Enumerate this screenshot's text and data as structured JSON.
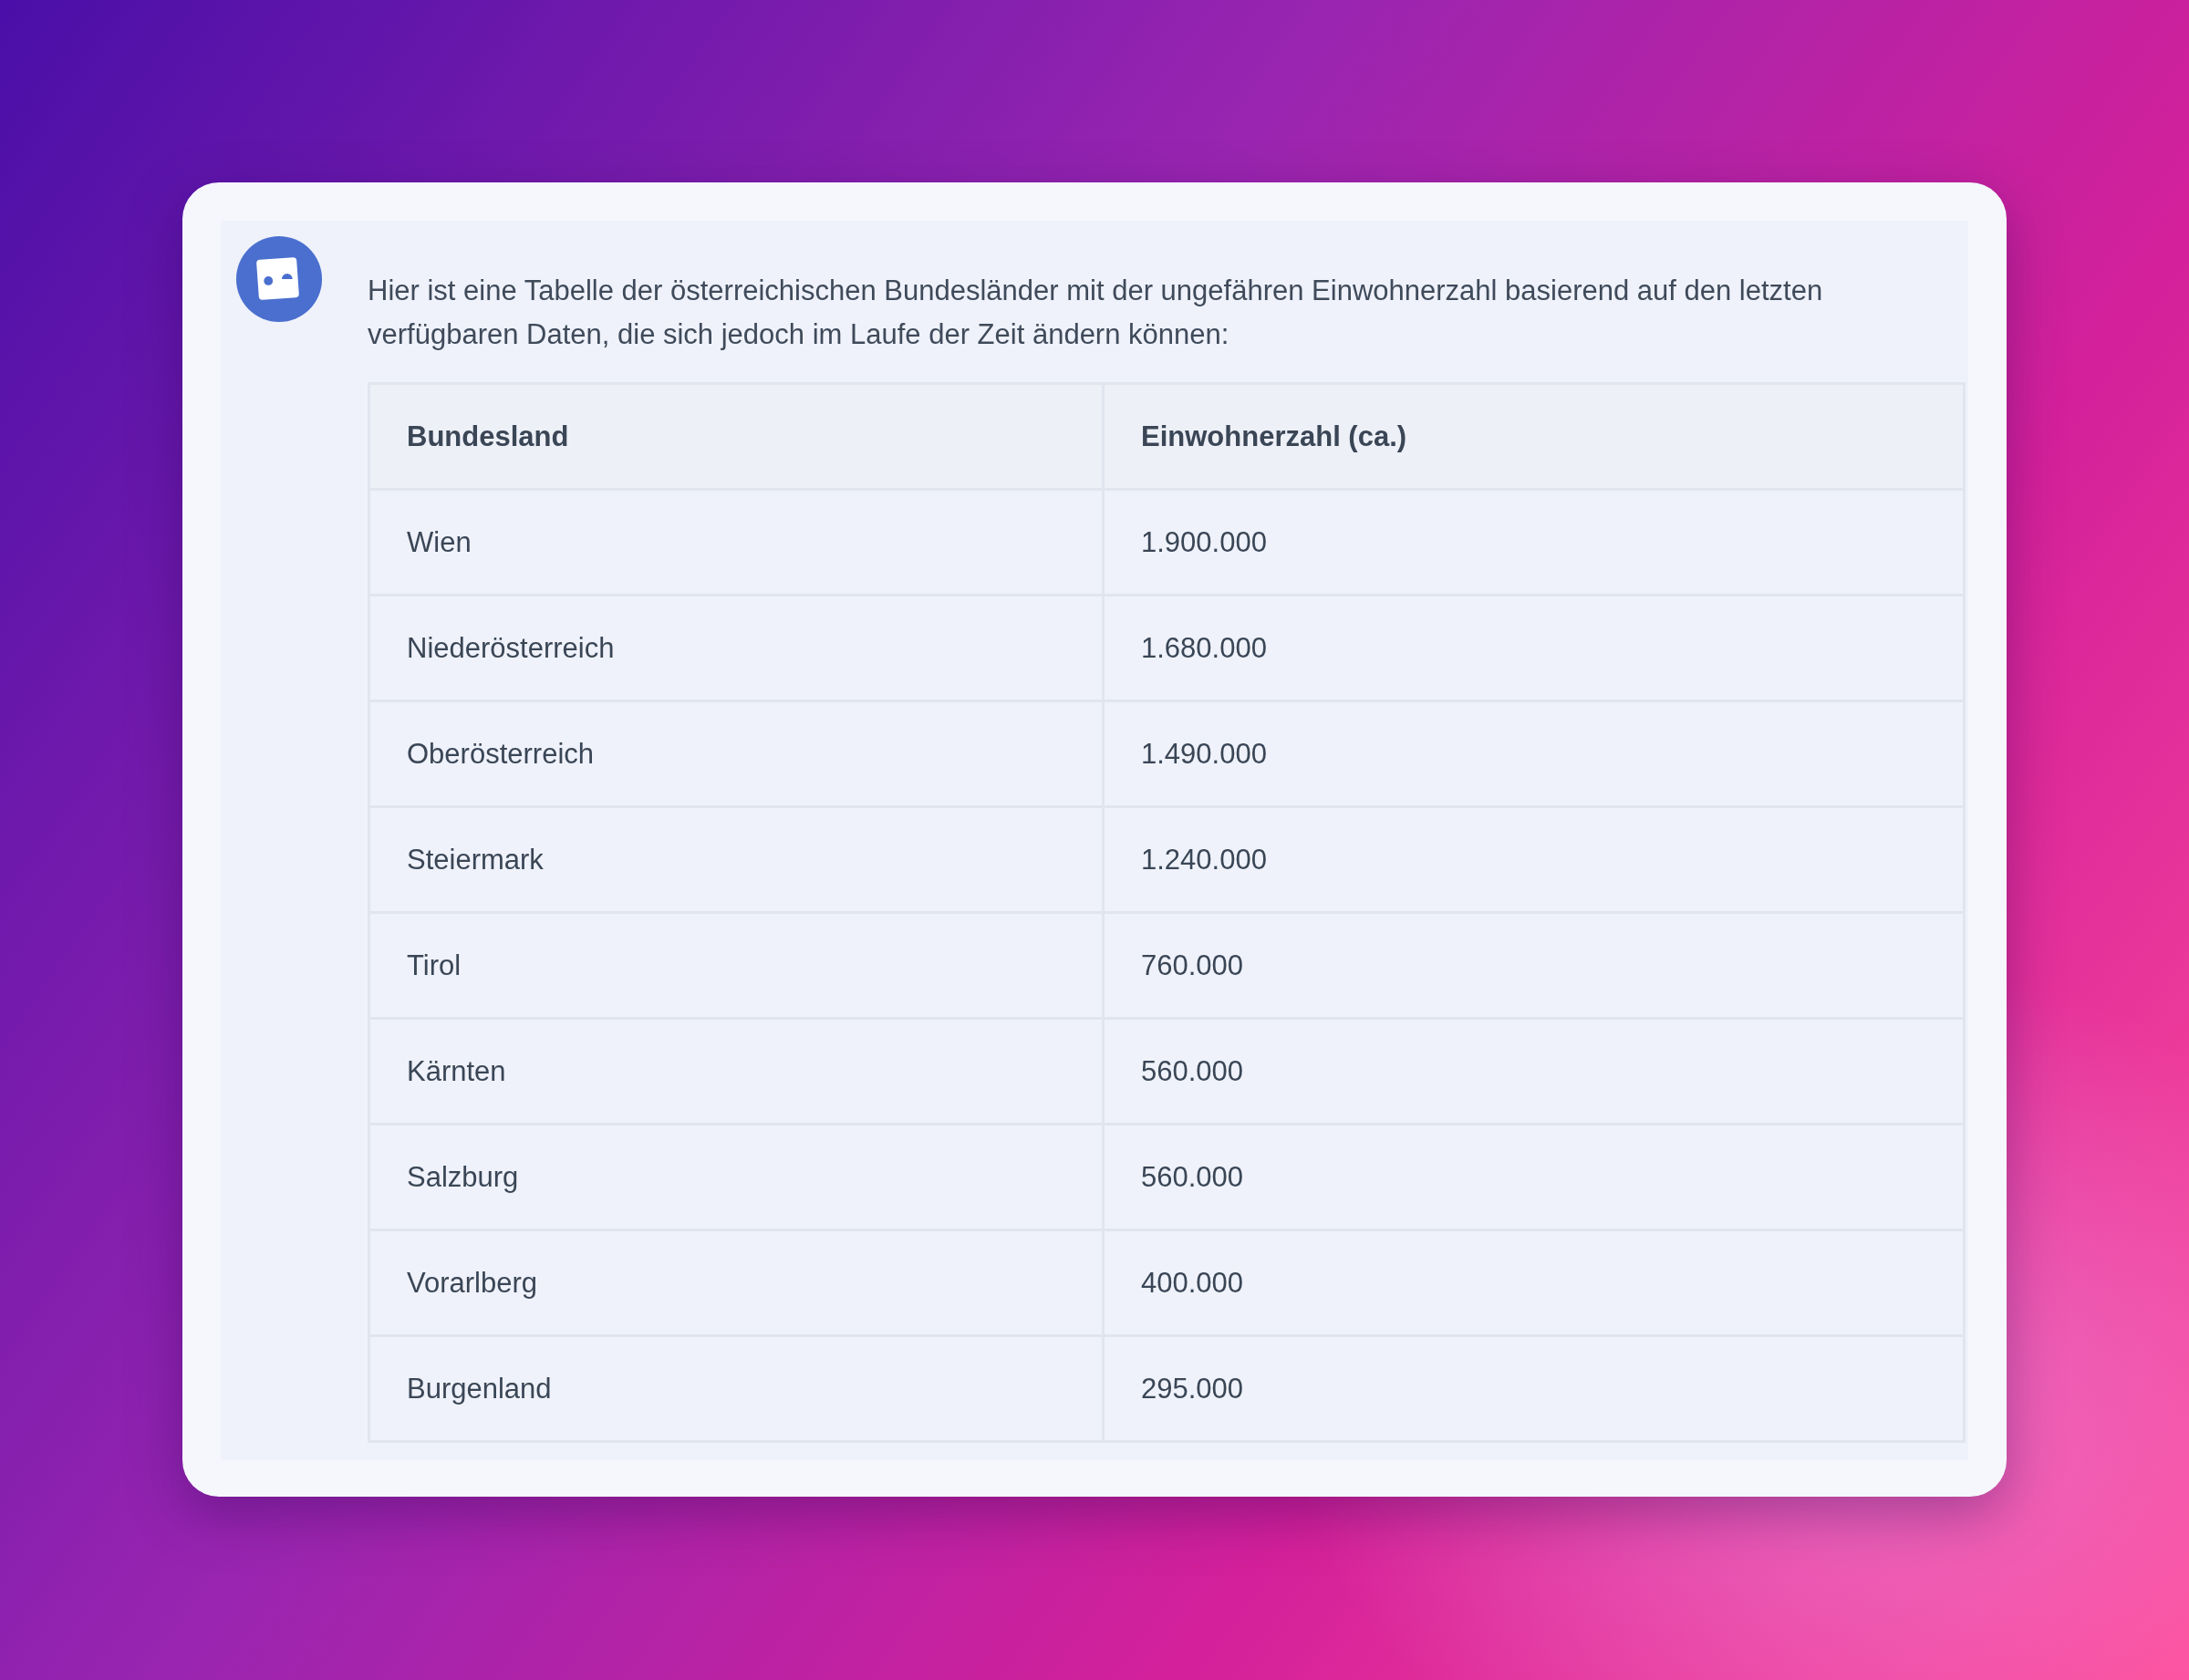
{
  "message": {
    "text": "Hier ist eine Tabelle der österreichischen Bundesländer mit der ungefähren Einwohnerzahl basierend auf den letzten verfügbaren Daten, die sich jedoch im Laufe der Zeit ändern können:"
  },
  "table": {
    "columns": [
      "Bundesland",
      "Einwohnerzahl (ca.)"
    ],
    "rows": [
      [
        "Wien",
        "1.900.000"
      ],
      [
        "Niederösterreich",
        "1.680.000"
      ],
      [
        "Oberösterreich",
        "1.490.000"
      ],
      [
        "Steiermark",
        "1.240.000"
      ],
      [
        "Tirol",
        "760.000"
      ],
      [
        "Kärnten",
        "560.000"
      ],
      [
        "Salzburg",
        "560.000"
      ],
      [
        "Vorarlberg",
        "400.000"
      ],
      [
        "Burgenland",
        "295.000"
      ]
    ]
  }
}
